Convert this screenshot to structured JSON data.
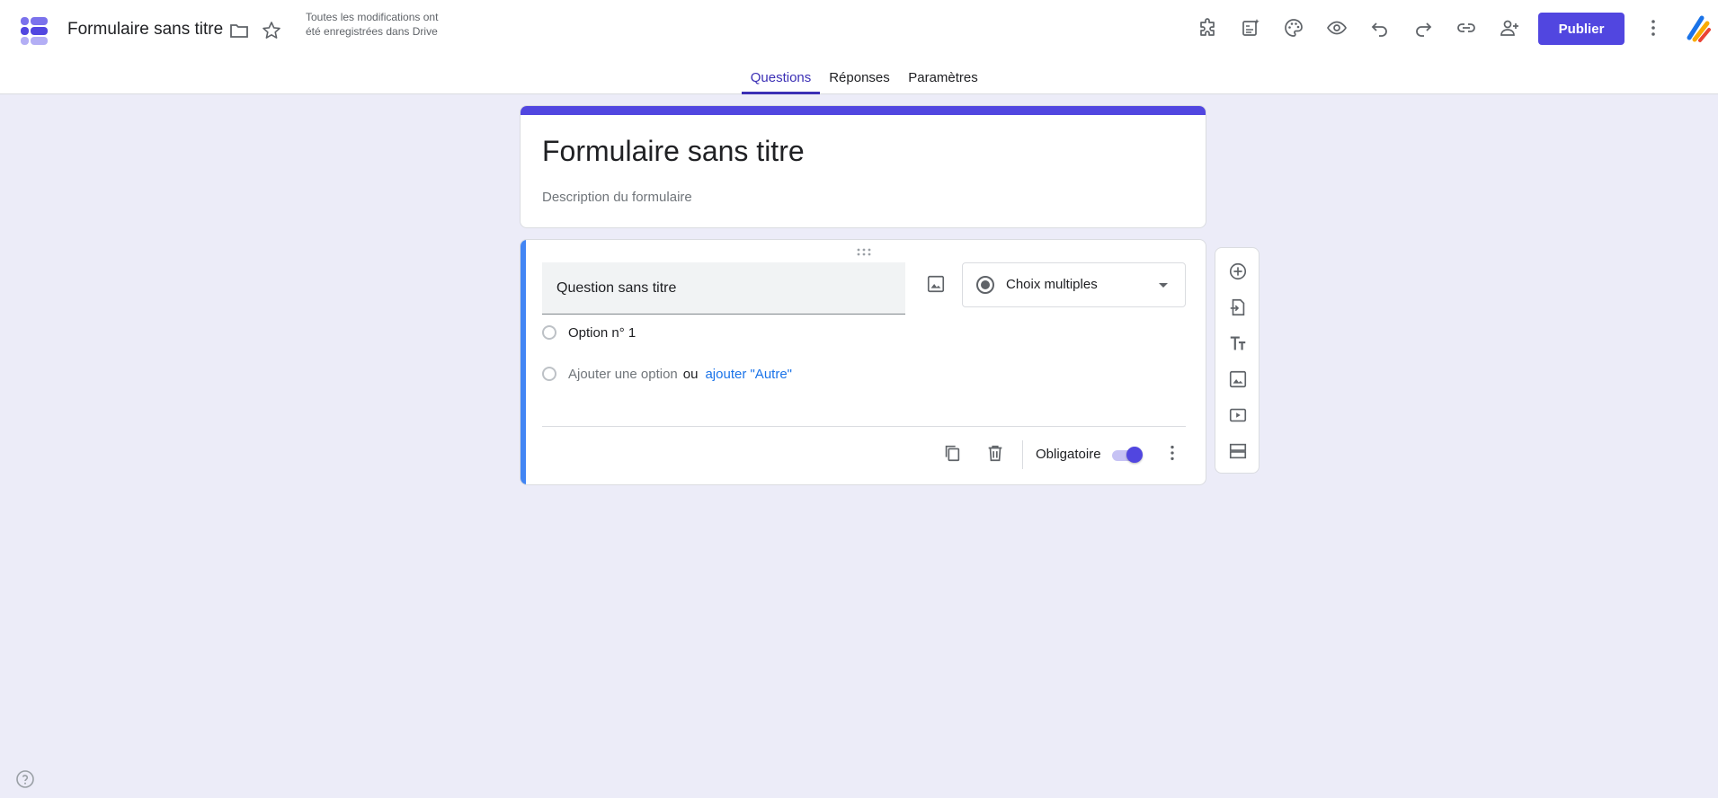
{
  "app": {
    "doc_title": "Formulaire sans titre",
    "save_status": "Toutes les modifications ont été enregistrées dans Drive",
    "publish_label": "Publier",
    "brand_color": "#5146e0"
  },
  "toolbar_icons": [
    "addons-icon",
    "ai-form-icon",
    "palette-icon",
    "preview-icon",
    "undo-icon",
    "redo-icon",
    "link-icon",
    "add-collaborator-icon",
    "more-vert-icon"
  ],
  "tabs": [
    {
      "label": "Questions",
      "active": true
    },
    {
      "label": "Réponses",
      "active": false
    },
    {
      "label": "Paramètres",
      "active": false
    }
  ],
  "form": {
    "title": "Formulaire sans titre",
    "description_placeholder": "Description du formulaire"
  },
  "question": {
    "title": "Question sans titre",
    "type": "Choix multiples",
    "options": [
      "Option n° 1"
    ],
    "add_option": "Ajouter une option",
    "or_text": "ou",
    "add_other": "ajouter \"Autre\"",
    "required_label": "Obligatoire",
    "required": true
  },
  "side_tools": [
    "add-question-icon",
    "import-questions-icon",
    "add-title-icon",
    "add-image-icon",
    "add-video-icon",
    "add-section-icon"
  ]
}
